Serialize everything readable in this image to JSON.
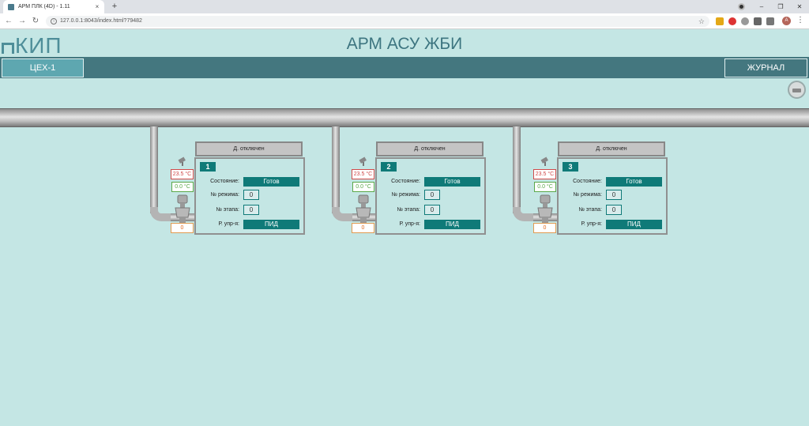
{
  "browser": {
    "tab_title": "АРМ ПЛК (4D) - 1.11",
    "tab_close": "×",
    "new_tab": "+",
    "url": "127.0.0.1:8043/index.html?79482",
    "avatar_letter": "A"
  },
  "app": {
    "logo_text": "КИП",
    "title": "АРМ АСУ ЖБИ",
    "nav_left": "ЦЕХ-1",
    "nav_right": "ЖУРНАЛ"
  },
  "labels": {
    "state": "Состояние:",
    "mode": "№ режима:",
    "stage": "№ этапа:",
    "control": "Р. упр-я:"
  },
  "units": [
    {
      "number": "1",
      "header": "Д. отключен",
      "state": "Готов",
      "mode": "0",
      "stage": "0",
      "control": "ПИД",
      "temp_actual": "23.5 °C",
      "temp_set": "0.0 °C",
      "value": "0"
    },
    {
      "number": "2",
      "header": "Д. отключен",
      "state": "Готов",
      "mode": "0",
      "stage": "0",
      "control": "ПИД",
      "temp_actual": "23.5 °C",
      "temp_set": "0.0 °C",
      "value": "0"
    },
    {
      "number": "3",
      "header": "Д. отключен",
      "state": "Готов",
      "mode": "0",
      "stage": "0",
      "control": "ПИД",
      "temp_actual": "23.5 °C",
      "temp_set": "0.0 °C",
      "value": "0"
    }
  ],
  "colors": {
    "background": "#c4e6e4",
    "navbar": "#44777f",
    "accent": "#0f7a78",
    "temp_alarm": "#d04a4a",
    "temp_ok": "#5aa84a"
  }
}
